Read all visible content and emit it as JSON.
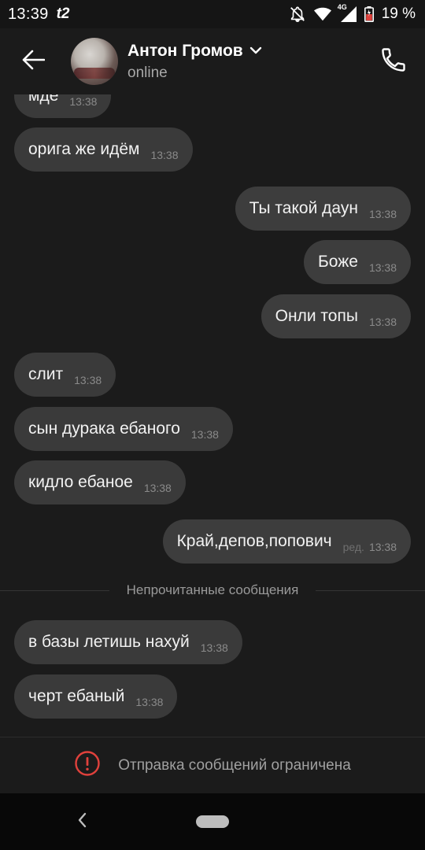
{
  "status_bar": {
    "time": "13:39",
    "carrier": "t2",
    "network": "4G",
    "battery_percent": "19 %"
  },
  "header": {
    "contact_name": "Антон Громов",
    "contact_status": "online"
  },
  "messages": [
    {
      "direction": "in",
      "text": "мде",
      "time": "13:38"
    },
    {
      "direction": "in",
      "text": "орига же идём",
      "time": "13:38"
    },
    {
      "direction": "out",
      "text": "Ты такой даун",
      "time": "13:38"
    },
    {
      "direction": "out",
      "text": "Боже",
      "time": "13:38"
    },
    {
      "direction": "out",
      "text": "Онли топы",
      "time": "13:38"
    },
    {
      "direction": "in",
      "text": "слит",
      "time": "13:38"
    },
    {
      "direction": "in",
      "text": "сын дурака ебаного",
      "time": "13:38"
    },
    {
      "direction": "in",
      "text": "кидло ебаное",
      "time": "13:38"
    },
    {
      "direction": "out",
      "text": "Край,депов,попович",
      "edited": "ред.",
      "time": "13:38"
    },
    {
      "direction": "in",
      "text": "в базы летишь нахуй",
      "time": "13:38"
    },
    {
      "direction": "in",
      "text": "черт ебаный",
      "time": "13:38"
    }
  ],
  "unread_divider": "Непрочитанные сообщения",
  "restricted_notice": "Отправка сообщений ограничена",
  "colors": {
    "background": "#1b1b1b",
    "bubble": "#3a3a3a",
    "alert_red": "#e0413c"
  },
  "icons": {
    "back": "arrow-left-icon",
    "dropdown": "chevron-down-icon",
    "call": "phone-icon",
    "alert": "alert-circle-icon",
    "mute": "bell-off-icon",
    "wifi": "wifi-icon",
    "signal": "signal-icon",
    "battery": "battery-icon"
  }
}
